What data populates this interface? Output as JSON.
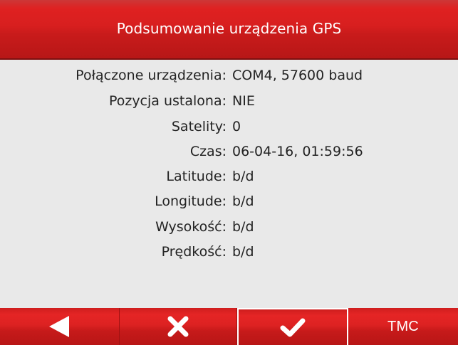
{
  "header": {
    "title": "Podsumowanie urządzenia GPS"
  },
  "summary": {
    "rows": [
      {
        "label": "Połączone urządzenia:",
        "value": "COM4, 57600 baud"
      },
      {
        "label": "Pozycja ustalona:",
        "value": "NIE"
      },
      {
        "label": "Satelity:",
        "value": "0"
      },
      {
        "label": "Czas:",
        "value": "06-04-16, 01:59:56"
      },
      {
        "label": "Latitude:",
        "value": "b/d"
      },
      {
        "label": "Longitude:",
        "value": "b/d"
      },
      {
        "label": "Wysokość:",
        "value": "b/d"
      },
      {
        "label": "Prędkość:",
        "value": "b/d"
      }
    ]
  },
  "toolbar": {
    "back_icon": "back-arrow-icon",
    "cancel_icon": "close-x-icon",
    "ok_icon": "checkmark-icon",
    "tmc_label": "TMC",
    "selected": "ok"
  },
  "colors": {
    "bar_red": "#d81f1f",
    "background": "#e9e9e9",
    "text": "#232323",
    "icon": "#ffffff"
  }
}
